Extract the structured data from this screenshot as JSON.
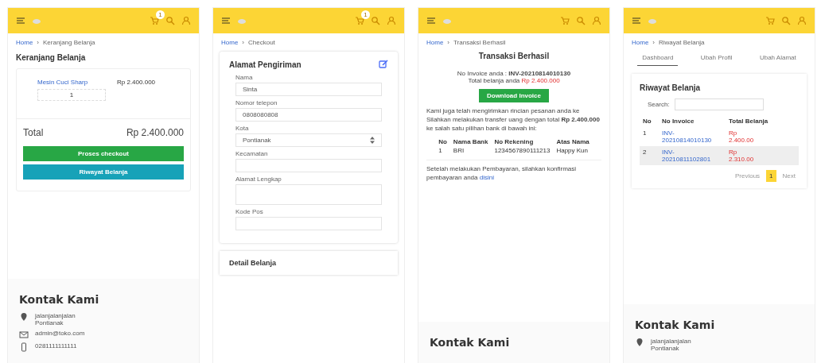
{
  "cart_page": {
    "header": {
      "cart_badge": "1"
    },
    "breadcrumb": {
      "home": "Home",
      "separator": "›",
      "current": "Keranjang Belanja"
    },
    "title": "Keranjang Belanja",
    "item": {
      "name": "Mesin Cuci Sharp",
      "quantity": "1",
      "price": "Rp 2.400.000"
    },
    "total_label": "Total",
    "total": "Rp 2.400.000",
    "buttons": [
      {
        "label": "Proses checkout",
        "kind": "success"
      },
      {
        "label": "Riwayat Belanja",
        "kind": "info"
      }
    ],
    "contact": {
      "title": "Kontak Kami",
      "items": [
        {
          "kind": "address",
          "text": "jalanjalanjalan Pontianak"
        },
        {
          "kind": "email",
          "text": "admin@toko.com"
        },
        {
          "kind": "phone",
          "text": "0281111111111"
        }
      ]
    }
  },
  "checkout_page": {
    "header": {
      "cart_badge": "1"
    },
    "breadcrumb": {
      "home": "Home",
      "separator": "›",
      "current": "Checkout"
    },
    "card_title": "Alamat Pengiriman",
    "fields": [
      {
        "label": "Nama",
        "kind": "text",
        "value": "Sinta"
      },
      {
        "label": "Nomor telepon",
        "kind": "text",
        "value": "0808080808"
      },
      {
        "label": "Kota",
        "kind": "select",
        "value": "Pontianak"
      },
      {
        "label": "Kecamatan",
        "kind": "text"
      },
      {
        "label": "Alamat Lengkap",
        "kind": "textarea"
      },
      {
        "label": "Kode Pos",
        "kind": "text"
      }
    ],
    "second_card_title": "Detail Belanja"
  },
  "success_page": {
    "breadcrumb": {
      "home": "Home",
      "separator": "›",
      "current": "Transaksi Berhasil"
    },
    "title": "Transaksi Berhasil",
    "invoice_line": "No Invoice anda : **INV-20210814010130**",
    "total_label": "Total belanja anda",
    "total_amount": "Rp 2.400.000",
    "download_button": "Download Invoice",
    "paragraphs": [
      "Kami juga telah mengirimkan rincian pesanan anda ke",
      "Silahkan melakukan transfer uang dengan total **Rp 2.400.000** ke salah satu pilihan bank di bawah ini:"
    ],
    "bank_table": {
      "columns": [
        "No",
        "Nama Bank",
        "No Rekening",
        "Atas Nama"
      ],
      "rows": [
        [
          "1",
          "BRI",
          "1234567890111213",
          "Happy Kun"
        ]
      ]
    },
    "confirm_text": "Setelah melakukan Pembayaran, silahkan konfirmasi pembayaran anda",
    "confirm_link": "disini",
    "contact": {
      "title": "Kontak Kami"
    }
  },
  "history_page": {
    "breadcrumb": {
      "home": "Home",
      "separator": "›",
      "current": "Riwayat Belanja"
    },
    "tabs": [
      {
        "label": "Dashboard",
        "selected": true
      },
      {
        "label": "Ubah Profil",
        "selected": false
      },
      {
        "label": "Ubah Alamat",
        "selected": false
      }
    ],
    "card_title": "Riwayat Belanja",
    "search_label": "Search:",
    "table": {
      "columns": [
        "No",
        "No Invoice",
        "Total Belanja"
      ],
      "rows": [
        {
          "no": "1",
          "invoice": "INV-20210814010130",
          "total": "Rp 2.400.00",
          "selected": false
        },
        {
          "no": "2",
          "invoice": "INV-20210811102801",
          "total": "Rp 2.310.00",
          "selected": true
        }
      ]
    },
    "pagination": [
      {
        "label": "Previous",
        "selected": false
      },
      {
        "label": "1",
        "selected": true
      },
      {
        "label": "Next",
        "selected": false
      }
    ],
    "contact": {
      "title": "Kontak Kami",
      "items": [
        {
          "kind": "address",
          "text": "jalanjalanjalan Pontianak"
        }
      ]
    }
  }
}
